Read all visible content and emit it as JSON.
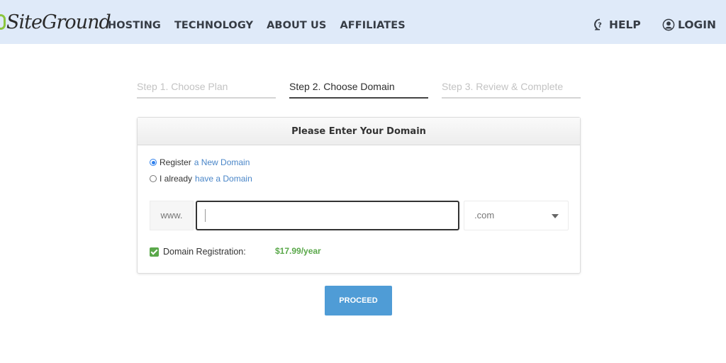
{
  "header": {
    "logo": "SiteGround",
    "nav": [
      "HOSTING",
      "TECHNOLOGY",
      "ABOUT US",
      "AFFILIATES"
    ],
    "help_label": "HELP",
    "login_label": "LOGIN"
  },
  "steps": [
    {
      "label": "Step 1. Choose Plan",
      "state": "inactive"
    },
    {
      "label": "Step 2. Choose Domain",
      "state": "active"
    },
    {
      "label": "Step 3. Review & Complete",
      "state": "inactive"
    }
  ],
  "card": {
    "title": "Please Enter Your Domain",
    "options": [
      {
        "prefix": "Register",
        "link": "a New Domain",
        "selected": true
      },
      {
        "prefix": "I already",
        "link": "have a Domain",
        "selected": false
      }
    ],
    "prefix": "www.",
    "domain_value": "",
    "tld_selected": ".com",
    "registration_label": "Domain Registration:",
    "registration_checked": true,
    "registration_price": "$17.99/year"
  },
  "proceed_label": "PROCEED",
  "colors": {
    "header_bg": "#dfeaf9",
    "accent_blue": "#4f9cd6",
    "link_blue": "#4a86c8",
    "price_green": "#5aa84a"
  }
}
